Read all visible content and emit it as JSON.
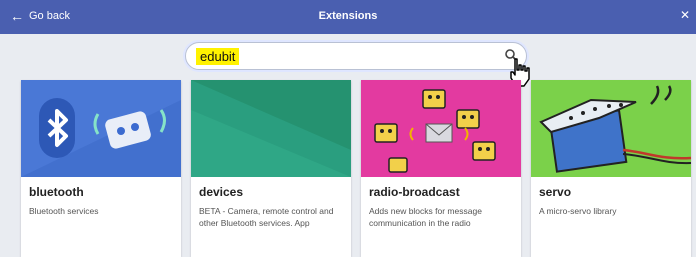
{
  "topbar": {
    "back_label": "Go back",
    "title": "Extensions"
  },
  "search": {
    "value": "edubit"
  },
  "cards": [
    {
      "title": "bluetooth",
      "desc": "Bluetooth services"
    },
    {
      "title": "devices",
      "desc": "BETA - Camera, remote control and other Bluetooth services. App"
    },
    {
      "title": "radio-broadcast",
      "desc": "Adds new blocks for message communication in the radio"
    },
    {
      "title": "servo",
      "desc": "A micro-servo library"
    }
  ],
  "colors": {
    "topbar": "#4a5fb0",
    "bluetooth": "#4a78d6",
    "devices": "#2a9e7f",
    "radio": "#e33aa0",
    "servo": "#7bd14a",
    "search_highlight": "#fff200"
  }
}
